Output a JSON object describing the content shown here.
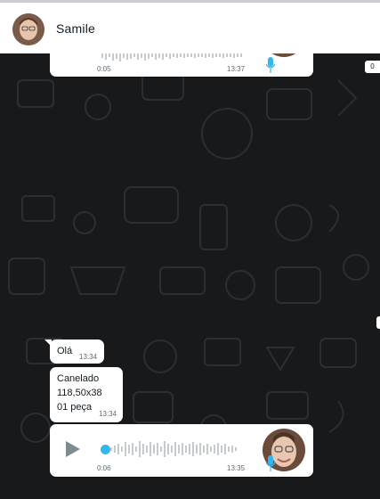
{
  "header": {
    "contact_name": "Samile",
    "avatar_icon": "contact-avatar"
  },
  "messages": {
    "voice_top": {
      "duration": "0:05",
      "time": "13:37"
    },
    "text_ola": {
      "text": "Olá",
      "time": "13:34"
    },
    "text_canelado": {
      "lines": [
        "Canelado",
        "118,50x38",
        "01 peça"
      ],
      "time": "13:34"
    },
    "voice_bottom": {
      "duration": "0:06",
      "time": "13:35",
      "progress": 0.0
    }
  },
  "side_badges": {
    "top": "0"
  },
  "colors": {
    "background": "#17191b",
    "bubble": "#ffffff",
    "accent_blue": "#34b7f1",
    "play_icon": "#7f8a91"
  }
}
